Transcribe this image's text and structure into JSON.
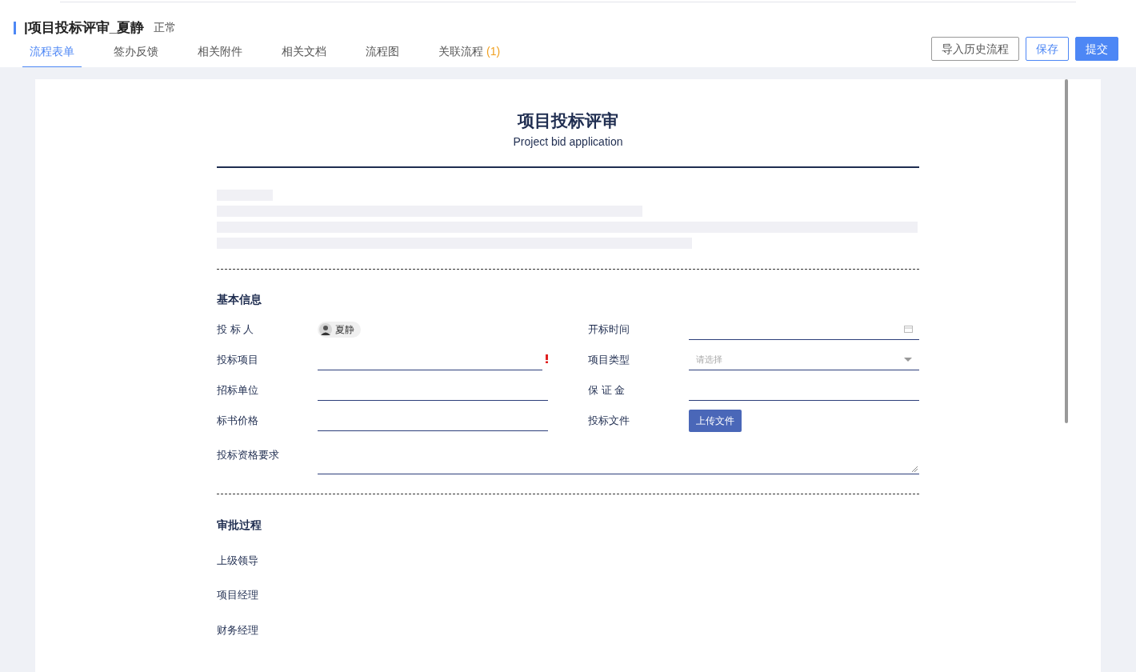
{
  "header": {
    "title": "|项目投标评审_夏静",
    "status": "正常"
  },
  "tabs": [
    {
      "label": "流程表单",
      "selected": true
    },
    {
      "label": "签办反馈",
      "selected": false
    },
    {
      "label": "相关附件",
      "selected": false
    },
    {
      "label": "相关文档",
      "selected": false
    },
    {
      "label": "流程图",
      "selected": false
    },
    {
      "label": "关联流程",
      "count": "(1)",
      "selected": false
    }
  ],
  "actions": [
    {
      "label": "导入历史流程",
      "kind": "default"
    },
    {
      "label": "保存",
      "kind": "outline"
    },
    {
      "label": "提交",
      "kind": "primary"
    }
  ],
  "form": {
    "title": "项目投标评审",
    "subtitle": "Project bid application",
    "basic_section": {
      "heading": "基本信息",
      "fields": [
        {
          "label": "投 标 人",
          "kind": "person",
          "value": "夏静"
        },
        {
          "label": "开标时间",
          "kind": "date"
        },
        {
          "label": "投标项目",
          "kind": "text",
          "required": true
        },
        {
          "label": "项目类型",
          "kind": "select",
          "placeholder": "请选择"
        },
        {
          "label": "招标单位",
          "kind": "text",
          "required": false
        },
        {
          "label": "保 证 金",
          "kind": "text",
          "required": false
        },
        {
          "label": "标书价格",
          "kind": "text",
          "required": false
        },
        {
          "label": "投标文件",
          "kind": "upload",
          "button": "上传文件"
        },
        {
          "label": "投标资格要求",
          "kind": "textarea"
        }
      ]
    },
    "approval_section": {
      "heading": "审批过程",
      "rows": [
        "上级领导",
        "项目经理",
        "财务经理"
      ]
    }
  }
}
